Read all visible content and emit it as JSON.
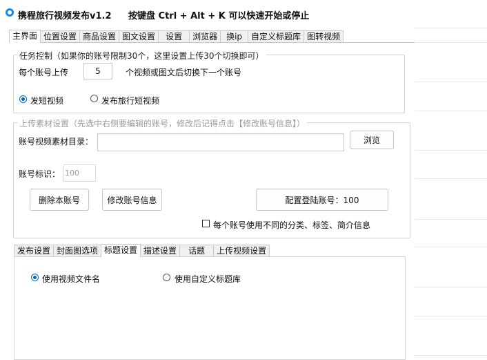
{
  "window": {
    "title": "携程旅行视频发布v1.2",
    "hotkey_hint": "按键盘 Ctrl + Alt + K  可以快速开始或停止"
  },
  "main_tabs": [
    {
      "label": "主界面",
      "active": true
    },
    {
      "label": "位置设置"
    },
    {
      "label": "商品设置"
    },
    {
      "label": "图文设置"
    },
    {
      "label": "设置"
    },
    {
      "label": "浏览器"
    },
    {
      "label": "换ip"
    },
    {
      "label": "自定义标题库"
    },
    {
      "label": "图转视频"
    }
  ],
  "task_control": {
    "legend": "任务控制（如果你的账号限制30个，这里设置上传30个切换即可）",
    "per_account_label": "每个账号上传",
    "per_account_value": "5",
    "per_account_suffix": "个视频或图文后切换下一个账号",
    "radio_short_video": "发短视频",
    "radio_travel_video": "发布旅行短视频"
  },
  "upload_settings": {
    "legend": "上传素材设置（先选中右侧要编辑的账号，修改后记得点击【修改账号信息】）",
    "material_dir_label": "账号视频素材目录：",
    "material_dir_value": "",
    "browse_button": "浏览",
    "account_id_label": "账号标识：",
    "account_id_value": "100",
    "delete_button": "删除本账号",
    "modify_button": "修改账号信息",
    "config_login_button": "配置登陆账号：100",
    "checkbox_label": "每个账号使用不同的分类、标签、简介信息"
  },
  "sub_tabs": [
    {
      "label": "发布设置"
    },
    {
      "label": "封面图选项"
    },
    {
      "label": "标题设置",
      "active": true
    },
    {
      "label": "描述设置"
    },
    {
      "label": "话题"
    },
    {
      "label": "上传视频设置"
    }
  ],
  "title_settings": {
    "radio_use_filename": "使用视频文件名",
    "radio_use_custom": "使用自定义标题库"
  },
  "colors": {
    "accent": "#0067c0",
    "border": "#c9c9c9"
  }
}
